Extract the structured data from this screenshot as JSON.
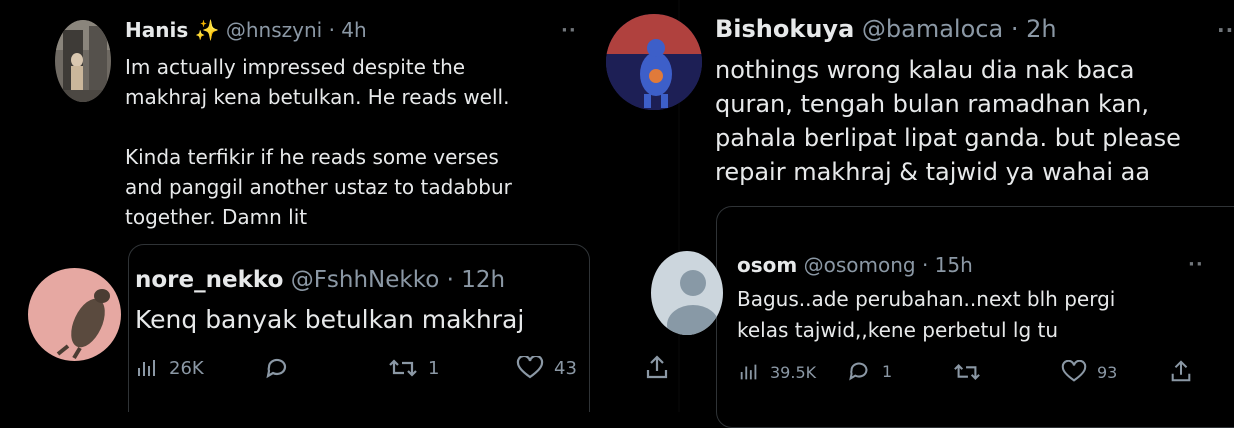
{
  "left": {
    "tweet1": {
      "name": "Hanis",
      "emoji": "✨",
      "handle": "@hnszyni",
      "time": "· 4h",
      "body": "Im actually impressed despite the\nmakhraj kena betulkan. He reads well.\n\nKinda terfikir if he reads some verses\nand panggil another ustaz to tadabbur\ntogether. Damn lit"
    },
    "tweet2": {
      "name": "nore_nekko",
      "handle": "@FshhNekko",
      "time": "· 12h",
      "body": "Kenq banyak betulkan makhraj",
      "views": "26K",
      "replies": "",
      "retweets": "1",
      "likes": "43"
    }
  },
  "right": {
    "tweet1": {
      "name": "Bishokuya",
      "handle": "@bamaloca",
      "time": "· 2h",
      "body": "nothings wrong kalau dia nak baca\nquran, tengah bulan ramadhan kan,\npahala berlipat lipat ganda. but please\nrepair makhraj & tajwid ya wahai aa"
    },
    "tweet2": {
      "name": "osom",
      "handle": "@osomong",
      "time": "· 15h",
      "body": "Bagus..ade perubahan..next blh pergi\nkelas tajwid,,kene perbetul lg tu",
      "views": "39.5K",
      "replies": "1",
      "retweets": "",
      "likes": "93"
    }
  },
  "more_label": "··",
  "colors": {
    "background": "#000000",
    "text": "#e7e9ea",
    "muted": "#8b98a5",
    "border": "#2f3336"
  },
  "icons": [
    "views-icon",
    "reply-icon",
    "retweet-icon",
    "like-icon",
    "share-icon",
    "more-icon"
  ]
}
